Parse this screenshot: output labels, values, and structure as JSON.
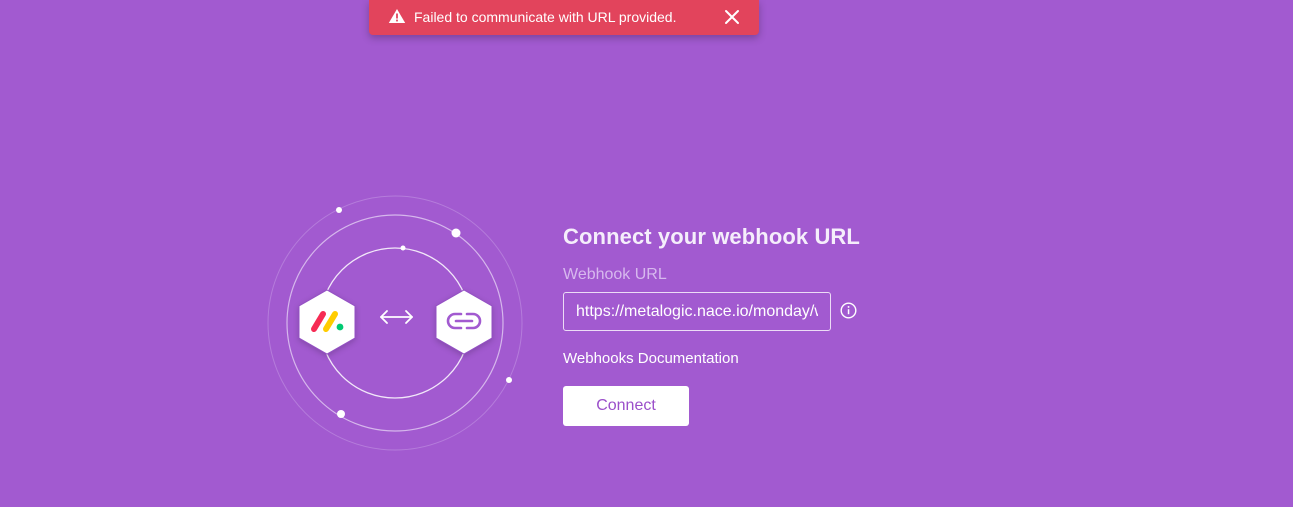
{
  "toast": {
    "message": "Failed to communicate with URL provided.",
    "icon": "warning-triangle-icon",
    "close_icon": "close-icon",
    "background_color": "#e2445c"
  },
  "illustration": {
    "left_logo": "monday-logo",
    "arrow_icon": "bidirectional-arrow-icon",
    "right_logo": "webhook-link-logo"
  },
  "form": {
    "title": "Connect your webhook URL",
    "field_label": "Webhook URL",
    "url_value": "https://metalogic.nace.io/monday/w",
    "info_icon": "info-icon",
    "docs_link": "Webhooks Documentation",
    "connect_label": "Connect"
  },
  "colors": {
    "background": "#a25ad0",
    "accent": "#9b4fca",
    "error": "#e2445c"
  }
}
